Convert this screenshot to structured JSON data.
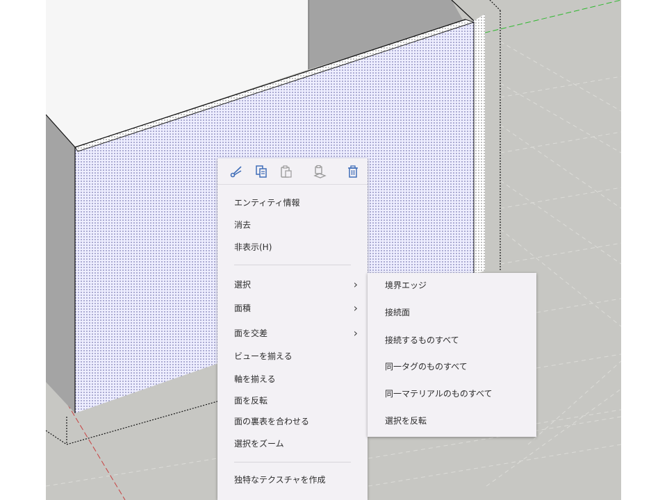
{
  "colors": {
    "background": "#c7c7c3",
    "wall_front": "#eeeeff",
    "wall_side": "#a4a4a4",
    "menu_bg": "#f3f1f5",
    "icon_blue": "#3f6db8",
    "icon_gray": "#5a5a5a",
    "axis_green": "#2eb82e",
    "axis_red": "#c84040"
  },
  "toolbar": {
    "icons": [
      "scissors-icon",
      "copy-icon",
      "paste-icon",
      "paste-in-place-icon",
      "trash-icon"
    ]
  },
  "menu": {
    "items": [
      {
        "label": "エンティティ情報"
      },
      {
        "label": "消去"
      },
      {
        "label": "非表示(H)"
      },
      {
        "label": "選択",
        "arrow": "›"
      },
      {
        "label": "面積",
        "arrow": "›"
      },
      {
        "label": "面を交差",
        "arrow": "›"
      },
      {
        "label": "ビューを揃える"
      },
      {
        "label": "軸を揃える"
      },
      {
        "label": "面を反転"
      },
      {
        "label": "面の裏表を合わせる"
      },
      {
        "label": "選択をズーム"
      },
      {
        "label": "独特なテクスチャを作成"
      }
    ]
  },
  "submenu": {
    "items": [
      {
        "label": "境界エッジ"
      },
      {
        "label": "接続面"
      },
      {
        "label": "接続するものすべて"
      },
      {
        "label": "同一タグのものすべて"
      },
      {
        "label": "同一マテリアルのものすべて"
      },
      {
        "label": "選択を反転"
      }
    ]
  }
}
